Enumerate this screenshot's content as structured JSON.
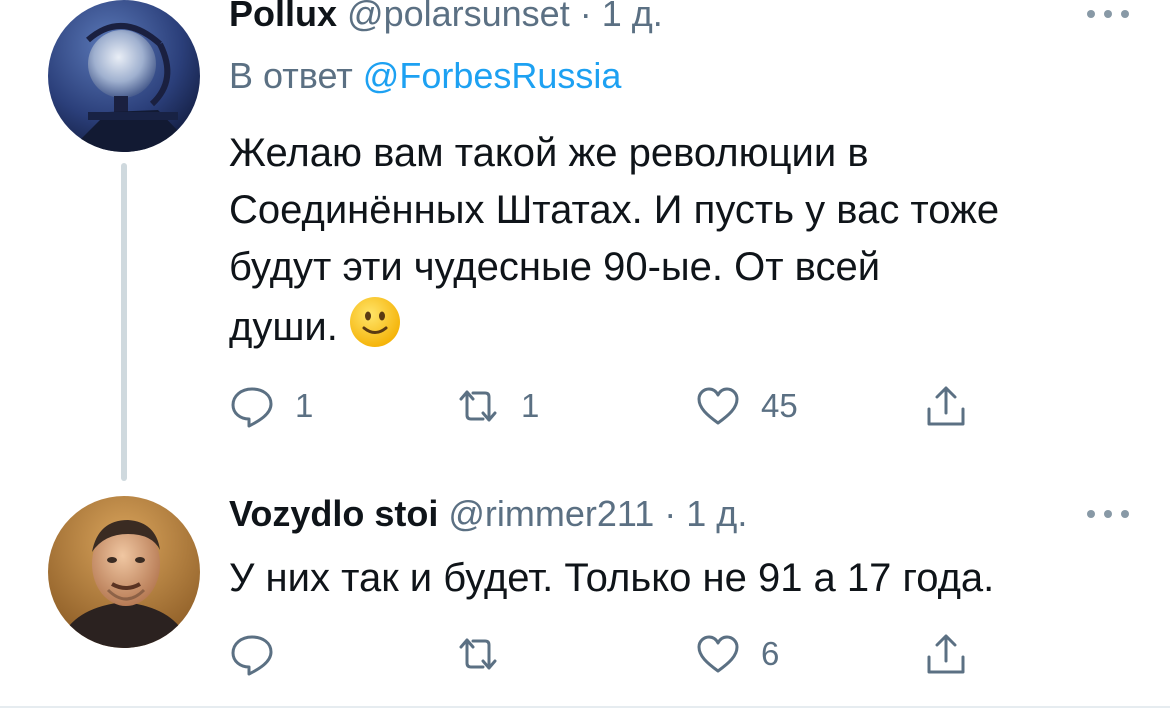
{
  "tweets": [
    {
      "name": "Pollux",
      "handle": "@polarsunset",
      "time": "· 1 д.",
      "reply_prefix": "В ответ",
      "reply_mention": "@ForbesRussia",
      "text_lines": [
        "Желаю вам такой же революции в",
        "Соединённых Штатах. И пусть у вас тоже",
        "будут эти чудесные 90-ые. От всей",
        "души."
      ],
      "emoji": "slightly-smiling-face",
      "replies": "1",
      "retweets": "1",
      "likes": "45"
    },
    {
      "name": "Vozydlo stoi",
      "handle": "@rimmer211",
      "time": "· 1 д.",
      "text": "У них так и будет. Только не 91 а 17 года.",
      "replies": "",
      "retweets": "",
      "likes": "6"
    }
  ],
  "icons": {
    "reply": "speech-bubble-icon",
    "retweet": "retweet-arrows-icon",
    "like": "heart-icon",
    "share": "share-upload-icon",
    "more": "ellipsis-icon"
  },
  "colors": {
    "text": "#0f1419",
    "secondary": "#5b7083",
    "link": "#1da1f2",
    "thread_line": "#cfd9de"
  }
}
